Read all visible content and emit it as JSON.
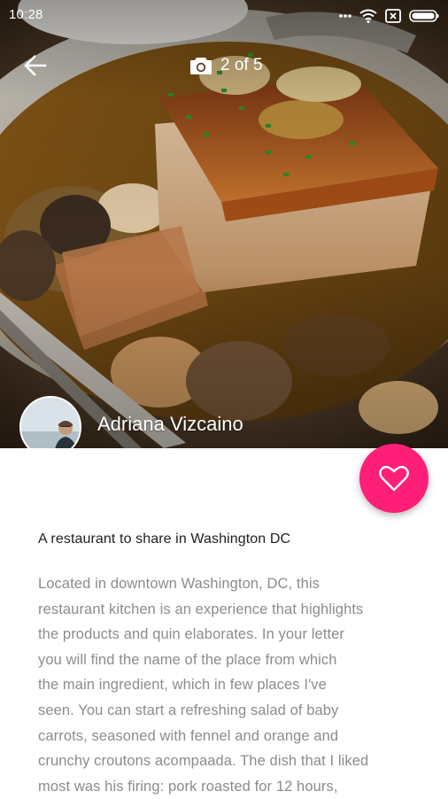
{
  "status_bar": {
    "time": "10:28"
  },
  "header": {
    "back_icon": "arrow-left-icon",
    "camera_icon": "camera-icon",
    "photo_counter": "2 of 5"
  },
  "author": {
    "name": "Adriana Vizcaino",
    "avatar_icon": "avatar-photo"
  },
  "like_button": {
    "icon": "heart-outline-icon",
    "color": "#ff1f78"
  },
  "post": {
    "title": "A restaurant to share in Washington DC",
    "body_lines": [
      "Located in downtown Washington, DC, this",
      "restaurant kitchen is an experience that highlights",
      "the products and quin elaborates. In your letter",
      "you will find the name of the place from which",
      "the main ingredient, which in few places I've",
      "seen. You can start a refreshing salad of baby",
      "carrots, seasoned with fennel and orange and",
      "crunchy croutons acompaada. The dish that I liked",
      "most was his firing: pork roasted for 12 hours,"
    ]
  }
}
